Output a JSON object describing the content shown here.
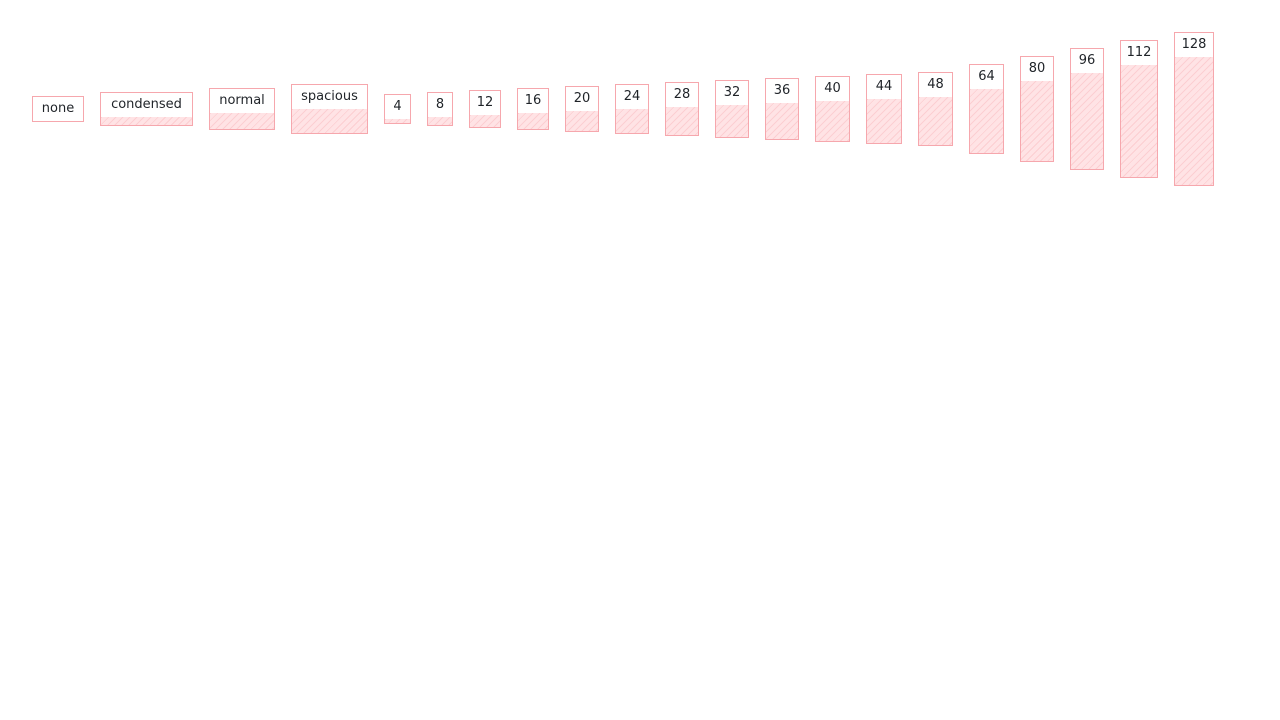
{
  "spacing_tokens": [
    {
      "label": "none",
      "value": 0
    },
    {
      "label": "condensed",
      "value": 8
    },
    {
      "label": "normal",
      "value": 16
    },
    {
      "label": "spacious",
      "value": 24
    },
    {
      "label": "4",
      "value": 4
    },
    {
      "label": "8",
      "value": 8
    },
    {
      "label": "12",
      "value": 12
    },
    {
      "label": "16",
      "value": 16
    },
    {
      "label": "20",
      "value": 20
    },
    {
      "label": "24",
      "value": 24
    },
    {
      "label": "28",
      "value": 28
    },
    {
      "label": "32",
      "value": 32
    },
    {
      "label": "36",
      "value": 36
    },
    {
      "label": "40",
      "value": 40
    },
    {
      "label": "44",
      "value": 44
    },
    {
      "label": "48",
      "value": 48
    },
    {
      "label": "64",
      "value": 64
    },
    {
      "label": "80",
      "value": 80
    },
    {
      "label": "96",
      "value": 96
    },
    {
      "label": "112",
      "value": 112
    },
    {
      "label": "128",
      "value": 128
    }
  ],
  "colors": {
    "border": "#f6a7ad",
    "fill": "#ffe3e5",
    "text": "#1f2328"
  }
}
